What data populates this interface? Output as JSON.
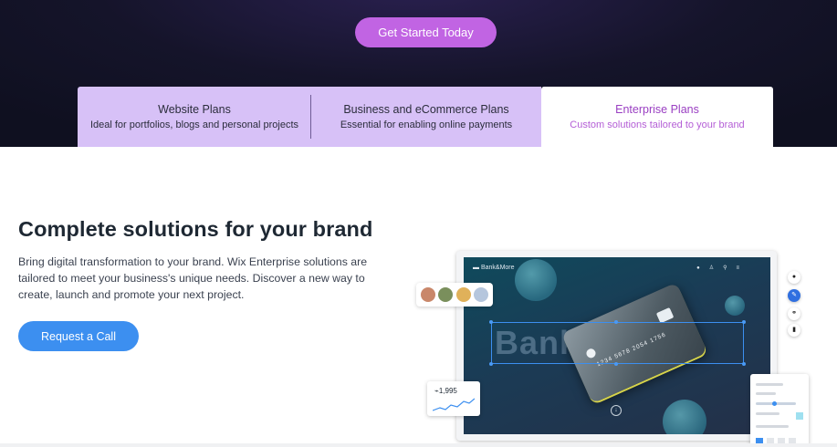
{
  "hero": {
    "cta_label": "Get Started Today"
  },
  "tabs": [
    {
      "title": "Website Plans",
      "subtitle": "Ideal for portfolios, blogs and personal projects"
    },
    {
      "title": "Business and eCommerce Plans",
      "subtitle": "Essential for enabling online payments"
    },
    {
      "title": "Enterprise Plans",
      "subtitle": "Custom solutions tailored to your brand",
      "selected": true
    }
  ],
  "content": {
    "headline": "Complete solutions for your brand",
    "body": "Bring digital transformation to your brand. Wix Enterprise solutions are tailored to meet your business's unique needs. Discover a new way to create, launch and promote your next project.",
    "cta_label": "Request a Call"
  },
  "mockup": {
    "brand": "Bank&More",
    "big_text": "Bank&More",
    "card_number": "1234 5678 2054 1756",
    "stat_value": "1,995",
    "icons": [
      "bell-icon",
      "user-icon",
      "search-icon",
      "menu-icon"
    ]
  },
  "colors": {
    "hero_bg": "#15142a",
    "cta_purple": "#c164e3",
    "tab_bg": "#d7c1f7",
    "accent_blue": "#3c8ff0",
    "selected_tab_text": "#9a3fc2"
  }
}
